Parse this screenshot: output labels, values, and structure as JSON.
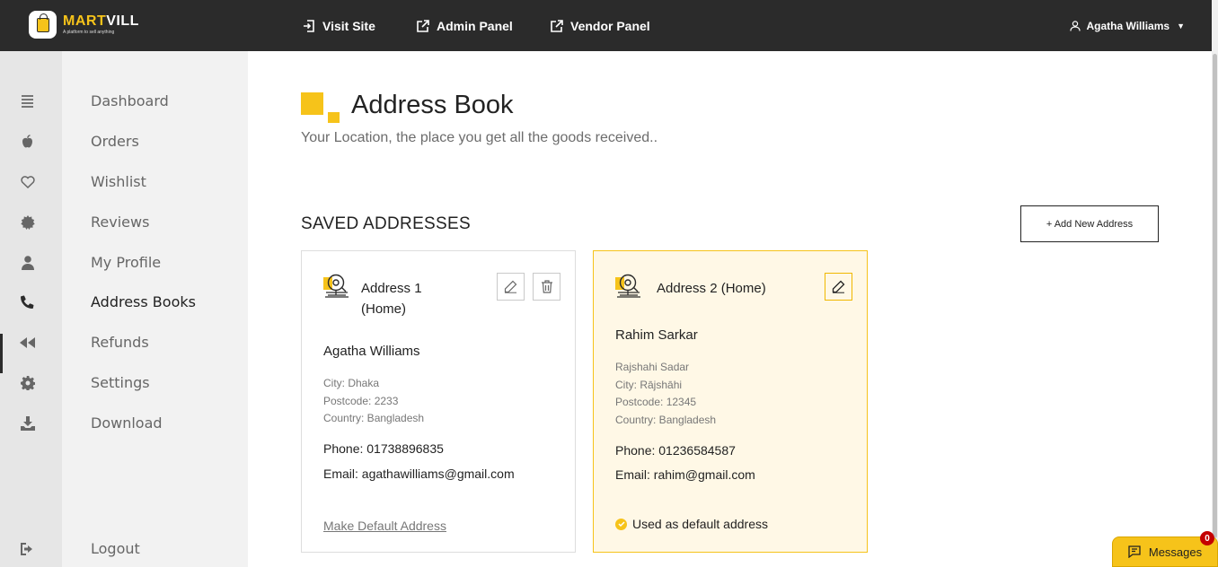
{
  "header": {
    "brand_primary": "MART",
    "brand_secondary": "VILL",
    "tagline": "A platform to sell anything",
    "nav": [
      {
        "label": "Visit Site",
        "icon": "enter-icon"
      },
      {
        "label": "Admin Panel",
        "icon": "external-link-icon"
      },
      {
        "label": "Vendor Panel",
        "icon": "external-link-icon"
      }
    ],
    "user_name": "Agatha Williams",
    "user_caret": "▼"
  },
  "sidebar": {
    "items": [
      {
        "label": "Dashboard",
        "icon": "list-icon"
      },
      {
        "label": "Orders",
        "icon": "apple-icon"
      },
      {
        "label": "Wishlist",
        "icon": "heart-icon"
      },
      {
        "label": "Reviews",
        "icon": "badge-icon"
      },
      {
        "label": "My Profile",
        "icon": "user-icon"
      },
      {
        "label": "Address Books",
        "icon": "phone-icon"
      },
      {
        "label": "Refunds",
        "icon": "rewind-icon"
      },
      {
        "label": "Settings",
        "icon": "gear-icon"
      },
      {
        "label": "Download",
        "icon": "download-icon"
      }
    ],
    "logout_label": "Logout",
    "active_index": 5
  },
  "page": {
    "title": "Address Book",
    "subtitle": "Your Location, the place you get all the goods received..",
    "section_title": "SAVED ADDRESSES",
    "add_button_label": "+ Add New Address"
  },
  "addresses": [
    {
      "title_line1": "Address 1",
      "title_line2": "(Home)",
      "name": "Agatha Williams",
      "city": "City: Dhaka",
      "postcode": "Postcode: 2233",
      "country": "Country: Bangladesh",
      "phone": "Phone: 01738896835",
      "email": "Email: agathawilliams@gmail.com",
      "action": "Make Default Address"
    },
    {
      "title": "Address 2 (Home)",
      "name": "Rahim Sarkar",
      "area": "Rajshahi Sadar",
      "city": "City: Rājshāhi",
      "postcode": "Postcode: 12345",
      "country": "Country: Bangladesh",
      "phone": "Phone: 01236584587",
      "email": "Email: rahim@gmail.com",
      "default_note": "Used as default address"
    }
  ],
  "messages": {
    "label": "Messages",
    "count": "0"
  },
  "colors": {
    "accent": "#f6c31a",
    "topbar": "#2b2b2b",
    "sidebar_bg": "#f2f2f2",
    "icon_rail_bg": "#e6e6e6",
    "default_card_bg": "#fff8e6"
  }
}
